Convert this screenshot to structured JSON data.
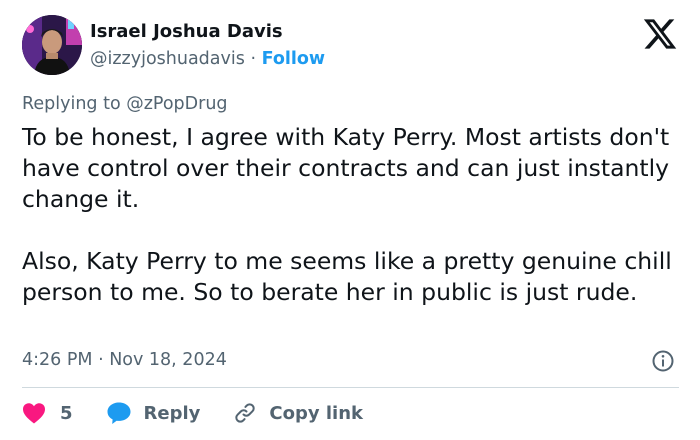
{
  "author": {
    "name": "Israel Joshua Davis",
    "handle": "@izzyjoshuadavis",
    "separator": "·",
    "follow_label": "Follow"
  },
  "reply_context": "Replying to @zPopDrug",
  "tweet": {
    "paragraphs": [
      "To be honest, I agree with Katy Perry. Most artists don't have control over their contracts and can just instantly change it.",
      "Also, Katy Perry to me seems like a pretty genuine chill person to me. So to berate her in public is just rude."
    ],
    "timestamp": "4:26 PM · Nov 18, 2024"
  },
  "actions": {
    "like_count": "5",
    "reply_label": "Reply",
    "copy_link_label": "Copy link"
  },
  "colors": {
    "text": "#0f1419",
    "secondary": "#536471",
    "accent": "#1d9bf0",
    "like": "#f91880",
    "divider": "#cfd9de"
  },
  "icons": [
    "x-logo-icon",
    "info-icon",
    "heart-icon",
    "speech-bubble-icon",
    "link-icon"
  ]
}
